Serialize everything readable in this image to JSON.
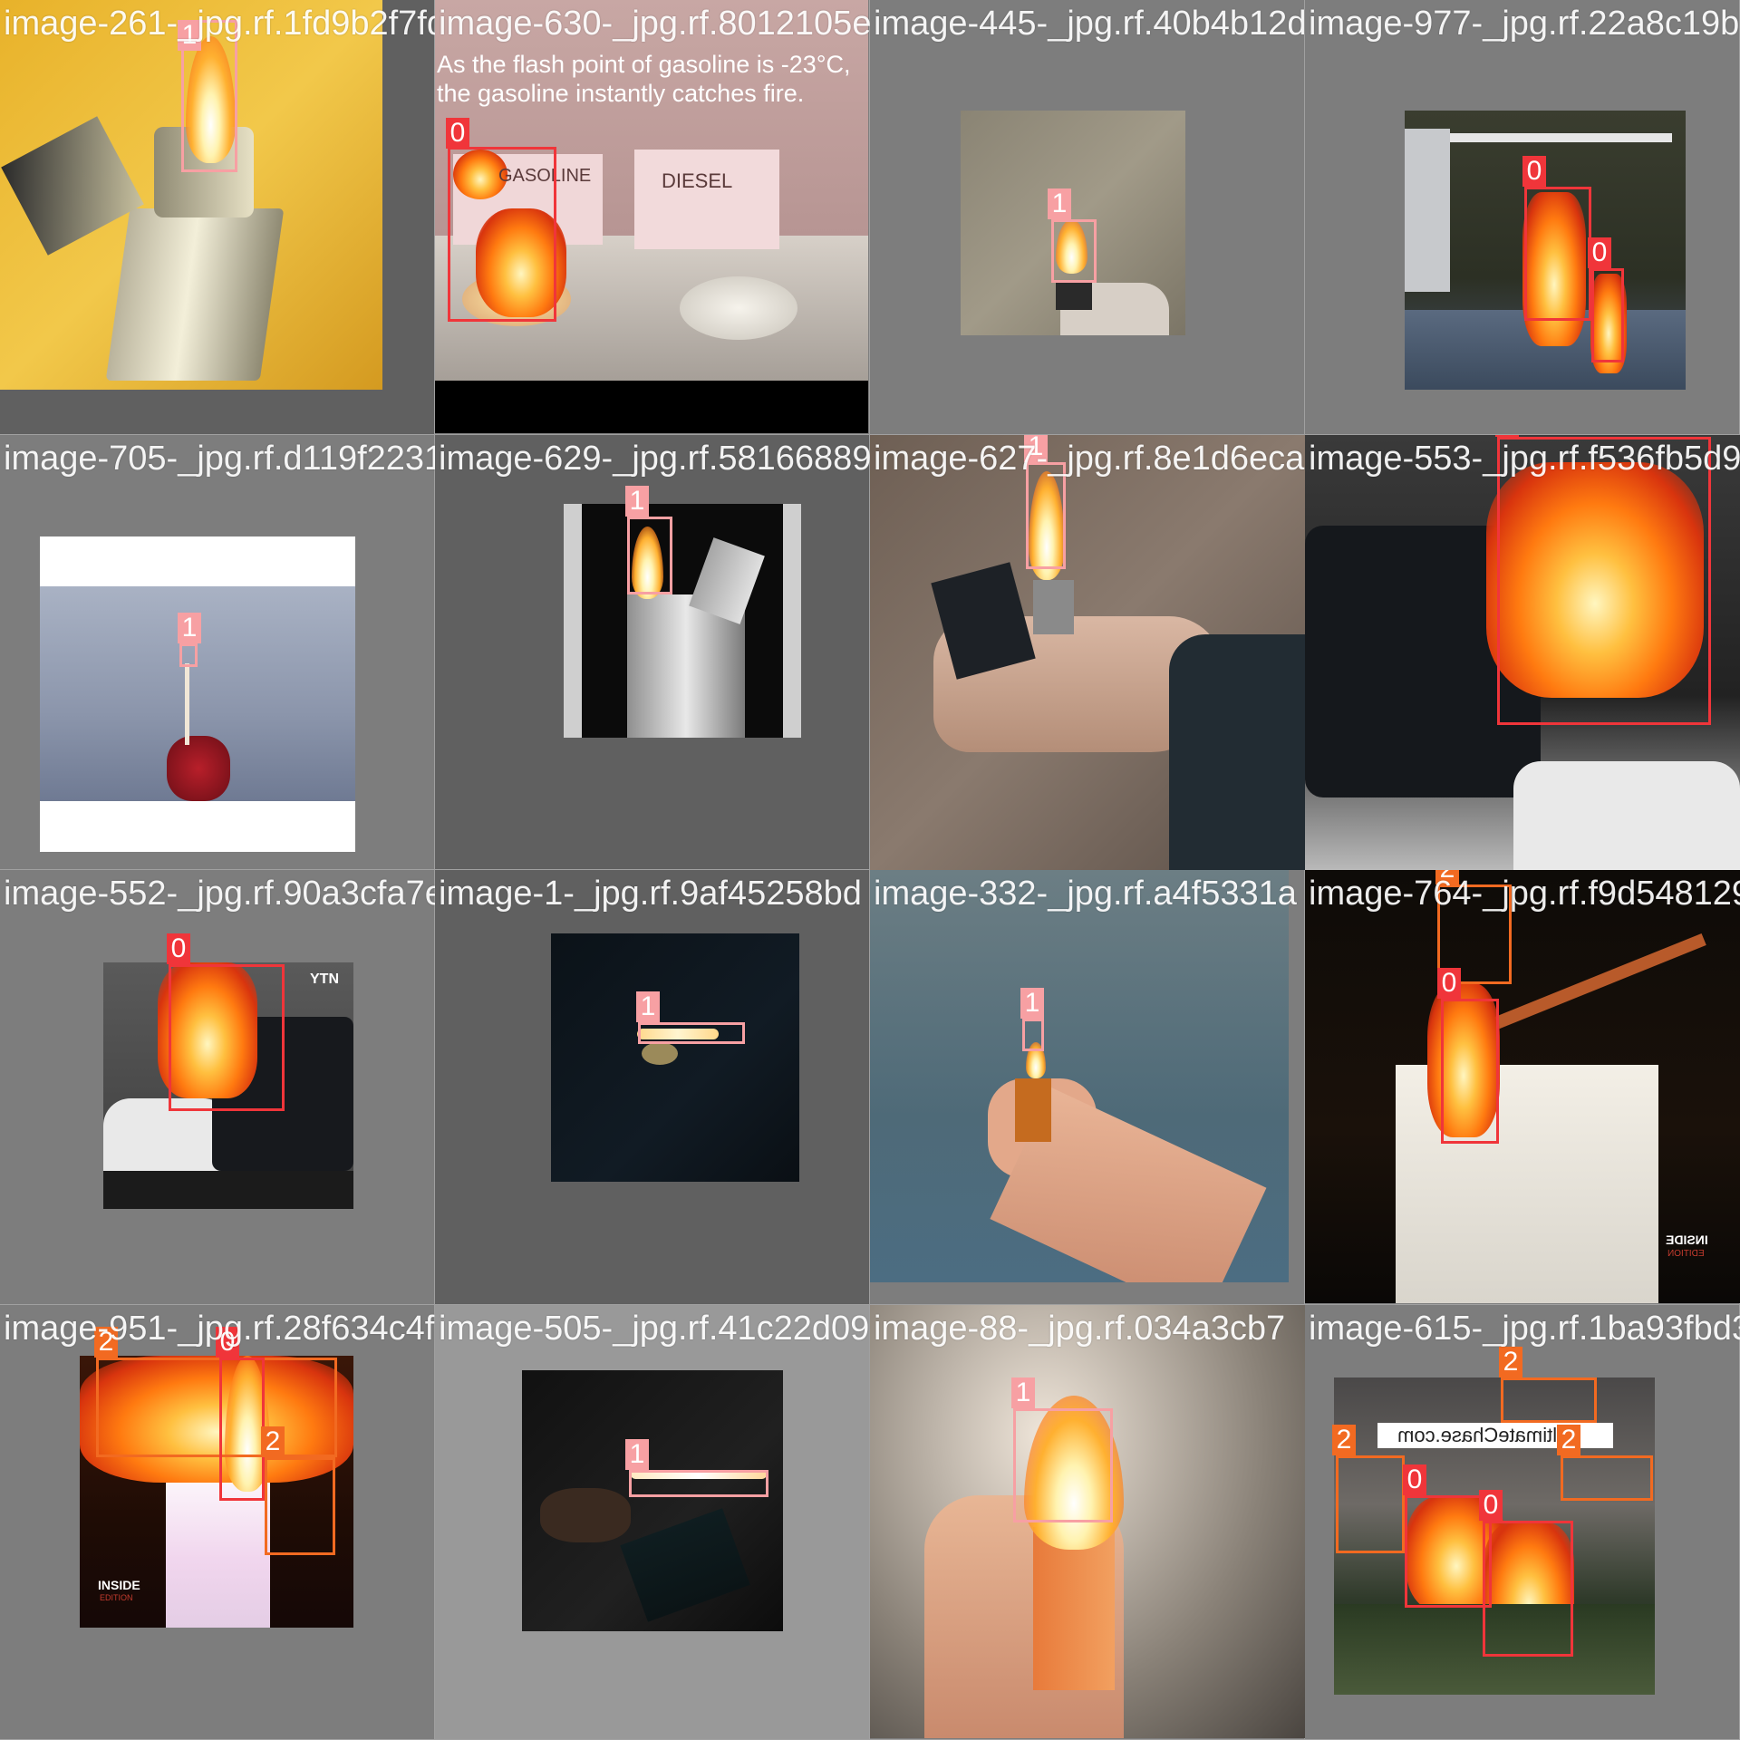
{
  "class_colors": {
    "0": "#f0353a",
    "1": "#f7a0a3",
    "2": "#f26a21"
  },
  "tiles": [
    {
      "filename": "image-261-_jpg.rf.1fd9b2f7fd7ea17690055bd",
      "labels": [
        "1"
      ]
    },
    {
      "filename": "image-630-_jpg.rf.8012105e56b37e7157fa5e3",
      "labels": [
        "0"
      ],
      "overlay": [
        "As the flash point of gasoline is -23°C,",
        "the gasoline instantly catches fire."
      ],
      "signs": [
        "GASOLINE",
        "DIESEL"
      ]
    },
    {
      "filename": "image-445-_jpg.rf.40b4b12d68ace94750b10",
      "labels": [
        "1"
      ]
    },
    {
      "filename": "image-977-_jpg.rf.22a8c19b",
      "labels": [
        "0",
        "0"
      ]
    },
    {
      "filename": "image-705-_jpg.rf.d119f2231",
      "labels": [
        "1"
      ]
    },
    {
      "filename": "image-629-_jpg.rf.581668897af2e22827",
      "labels": [
        "1"
      ]
    },
    {
      "filename": "image-627-_jpg.rf.8e1d6eca",
      "labels": [
        "1"
      ]
    },
    {
      "filename": "image-553-_jpg.rf.f536fb5d9",
      "labels": [
        "0"
      ]
    },
    {
      "filename": "image-552-_jpg.rf.90a3cfa7e",
      "labels": [
        "0"
      ],
      "overlay": [
        "YTN"
      ]
    },
    {
      "filename": "image-1-_jpg.rf.9af45258bd",
      "labels": [
        "1"
      ]
    },
    {
      "filename": "image-332-_jpg.rf.a4f5331a",
      "labels": [
        "1"
      ]
    },
    {
      "filename": "image-764-_jpg.rf.f9d548129",
      "labels": [
        "2",
        "0"
      ],
      "overlay": [
        "INSIDE",
        "EDITION"
      ]
    },
    {
      "filename": "image-951-_jpg.rf.28f634c4f",
      "labels": [
        "2",
        "0",
        "2"
      ],
      "overlay": [
        "INSIDE",
        "EDITION"
      ]
    },
    {
      "filename": "image-505-_jpg.rf.41c22d09",
      "labels": [
        "1"
      ]
    },
    {
      "filename": "image-88-_jpg.rf.034a3cb7",
      "labels": [
        "1"
      ]
    },
    {
      "filename": "image-615-_jpg.rf.1ba93fbd3",
      "labels": [
        "2",
        "2",
        "2",
        "0",
        "0"
      ],
      "overlay": [
        "UltimateChase.com"
      ]
    }
  ]
}
